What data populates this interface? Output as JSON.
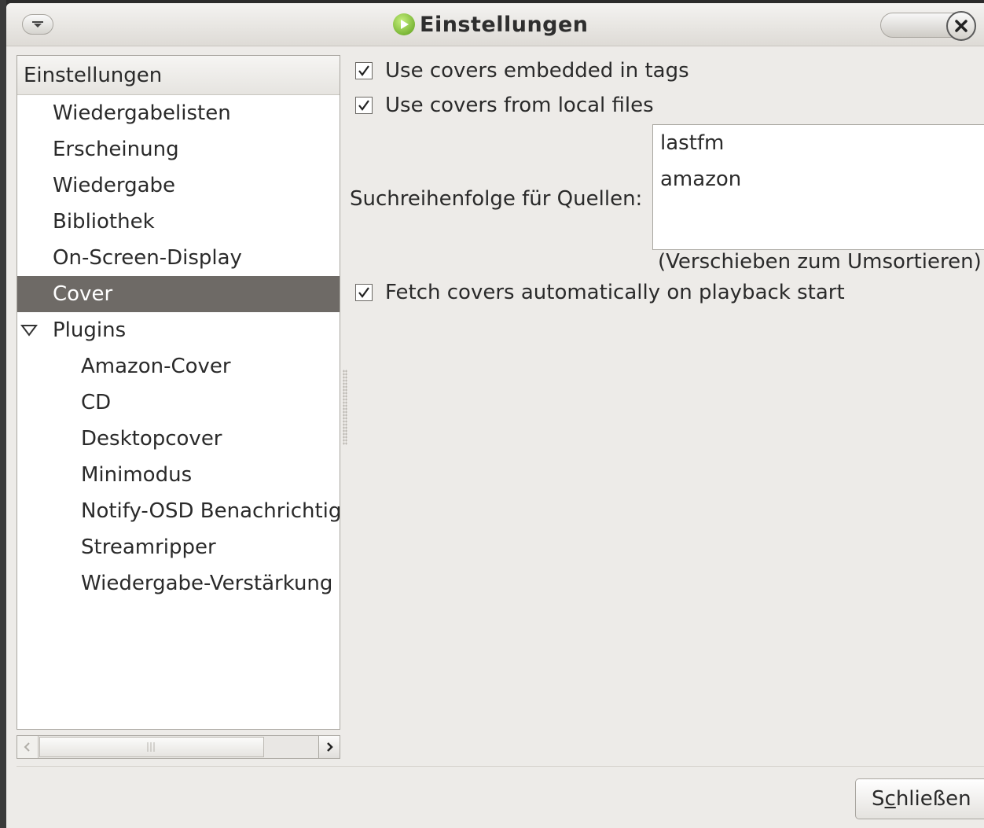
{
  "window": {
    "title": "Einstellungen"
  },
  "sidebar": {
    "header": "Einstellungen",
    "items": [
      {
        "label": "Wiedergabelisten",
        "level": 1
      },
      {
        "label": "Erscheinung",
        "level": 1
      },
      {
        "label": "Wiedergabe",
        "level": 1
      },
      {
        "label": "Bibliothek",
        "level": 1
      },
      {
        "label": "On-Screen-Display",
        "level": 1
      },
      {
        "label": "Cover",
        "level": 1,
        "selected": true
      },
      {
        "label": "Plugins",
        "level": 1,
        "expanded": true
      },
      {
        "label": "Amazon-Cover",
        "level": 2
      },
      {
        "label": "CD",
        "level": 2
      },
      {
        "label": "Desktopcover",
        "level": 2
      },
      {
        "label": "Minimodus",
        "level": 2
      },
      {
        "label": "Notify-OSD Benachrichtig",
        "level": 2
      },
      {
        "label": "Streamripper",
        "level": 2
      },
      {
        "label": "Wiedergabe-Verstärkung",
        "level": 2
      }
    ]
  },
  "cover_settings": {
    "embedded_label": "Use covers embedded in tags",
    "embedded_checked": true,
    "local_label": "Use covers from local files",
    "local_checked": true,
    "search_order_label": "Suchreihenfolge für Quellen:",
    "sources": [
      "lastfm",
      "amazon"
    ],
    "reorder_hint": "(Verschieben zum Umsortieren)",
    "fetch_label": "Fetch covers automatically on playback start",
    "fetch_checked": true
  },
  "footer": {
    "close_label_pre": "S",
    "close_label_mnemonic": "c",
    "close_label_post": "hließen"
  },
  "colors": {
    "selection": "#6e6a66",
    "window_bg": "#edebe8",
    "app_icon": "#5a9e18"
  }
}
